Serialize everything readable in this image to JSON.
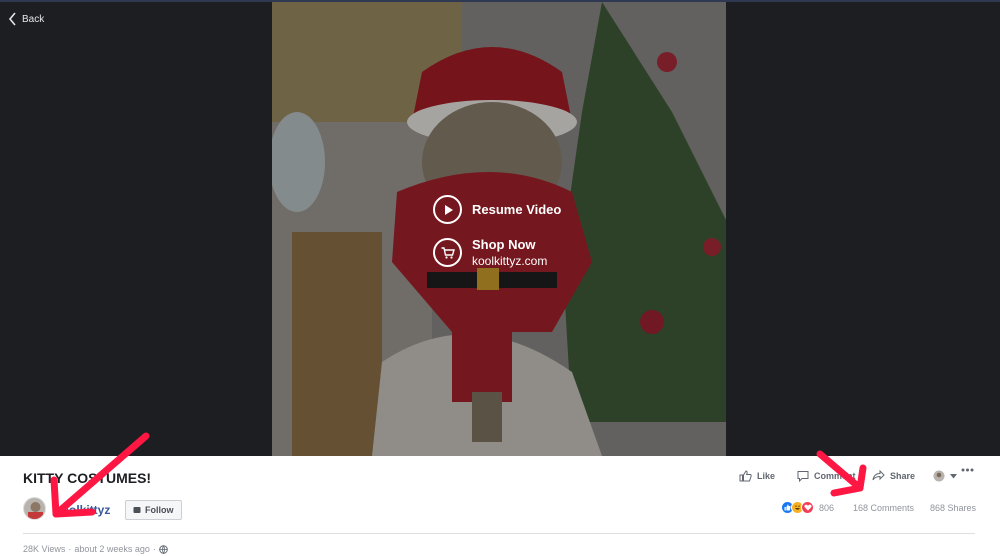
{
  "nav": {
    "back_label": "Back"
  },
  "video": {
    "resume_label": "Resume Video",
    "shop_label": "Shop Now",
    "shop_url": "koolkittyz.com"
  },
  "post": {
    "title": "KITTY COSTUMES!",
    "page_name": "koolkittyz",
    "follow_label": "Follow",
    "views": "28K Views",
    "separator": "·",
    "time_ago": "about 2 weeks ago"
  },
  "actions": {
    "like_label": "Like",
    "comment_label": "Comment",
    "share_label": "Share"
  },
  "stats": {
    "reactions_count": "806",
    "comments": "168 Comments",
    "shares": "868 Shares"
  },
  "icons": [
    "back-chevron-icon",
    "play-icon",
    "cart-icon",
    "follow-icon",
    "like-icon",
    "comment-icon",
    "share-icon",
    "globe-icon",
    "more-icon",
    "like-reaction-icon",
    "haha-reaction-icon",
    "love-reaction-icon"
  ],
  "colors": {
    "stage": "#1d1e21",
    "link": "#385898",
    "annotation": "#ff1744",
    "like": "#1877f2",
    "love": "#f33e58",
    "haha": "#f7b125"
  }
}
